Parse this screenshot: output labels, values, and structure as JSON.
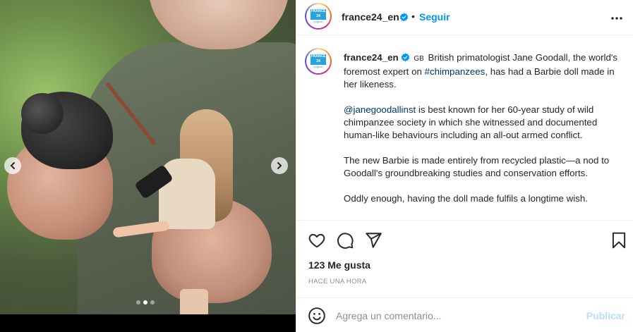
{
  "account": {
    "username": "france24_en",
    "follow_label": "Seguir",
    "separator": "•",
    "logo_text": "FRANCE 24",
    "logo_sub": "english"
  },
  "caption": {
    "username": "france24_en",
    "flag": "GB",
    "p1_text": "British primatologist Jane Goodall, the world's foremost expert on",
    "p1_hashtag": "#chimpanzees",
    "p1_rest": ", has had a Barbie doll made in her likeness.",
    "p2_mention": "@janegoodallinst",
    "p2_text": " is best known for her 60-year study of wild chimpanzee society in which she witnessed and documented human-like behaviours including an all-out armed conflict.",
    "p3": "The new Barbie is made entirely from recycled plastic—a nod to Goodall's groundbreaking studies and conservation efforts.",
    "p4": "Oddly enough, having the doll made fulfils a longtime wish."
  },
  "stats": {
    "likes": "123 Me gusta",
    "time": "HACE UNA HORA"
  },
  "comment": {
    "placeholder": "Agrega un comentario...",
    "post_label": "Publicar"
  },
  "carousel": {
    "total": 3,
    "active_index": 1
  },
  "colors": {
    "accent": "#0095f6",
    "post_disabled": "#b2dffc",
    "text": "#262626",
    "muted": "#8e8e8e"
  },
  "icons": [
    "chevron-left-icon",
    "chevron-right-icon",
    "verified-badge-icon",
    "more-options-icon",
    "heart-icon",
    "comment-icon",
    "share-icon",
    "bookmark-icon",
    "emoji-icon"
  ]
}
